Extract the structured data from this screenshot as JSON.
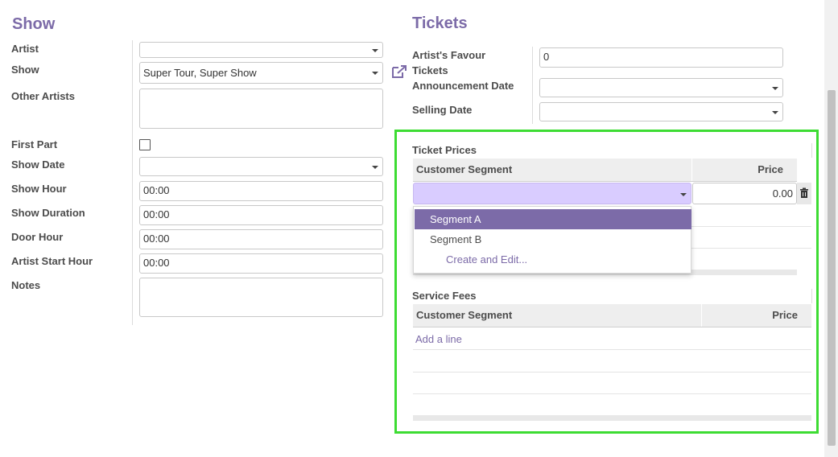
{
  "show": {
    "title": "Show",
    "labels": {
      "artist": "Artist",
      "show": "Show",
      "other_artists": "Other Artists",
      "first_part": "First Part",
      "show_date": "Show Date",
      "show_hour": "Show Hour",
      "show_duration": "Show Duration",
      "door_hour": "Door Hour",
      "artist_start_hour": "Artist Start Hour",
      "notes": "Notes"
    },
    "values": {
      "artist": "",
      "show": "Super Tour, Super Show",
      "other_artists": "",
      "first_part": false,
      "show_date": "",
      "show_hour": "00:00",
      "show_duration": "00:00",
      "door_hour": "00:00",
      "artist_start_hour": "00:00",
      "notes": ""
    }
  },
  "tickets": {
    "title": "Tickets",
    "labels": {
      "favour_line1": "Artist's Favour",
      "favour_line2": "Tickets",
      "announcement_date": "Announcement Date",
      "selling_date": "Selling Date"
    },
    "values": {
      "artists_favour_tickets": "0",
      "announcement_date": "",
      "selling_date": ""
    }
  },
  "ticket_prices": {
    "title": "Ticket Prices",
    "columns": [
      "Customer Segment",
      "Price"
    ],
    "editing_row": {
      "segment": "",
      "price": "0.00"
    },
    "dropdown": {
      "options": [
        "Segment A",
        "Segment B"
      ],
      "highlighted_index": 0,
      "create_edit": "Create and Edit..."
    }
  },
  "service_fees": {
    "title": "Service Fees",
    "columns": [
      "Customer Segment",
      "Price"
    ],
    "add_line": "Add a line"
  },
  "colors": {
    "accent": "#7c6ba8",
    "highlight_box": "#3ddc33",
    "selected_input": "#d9ccff"
  }
}
